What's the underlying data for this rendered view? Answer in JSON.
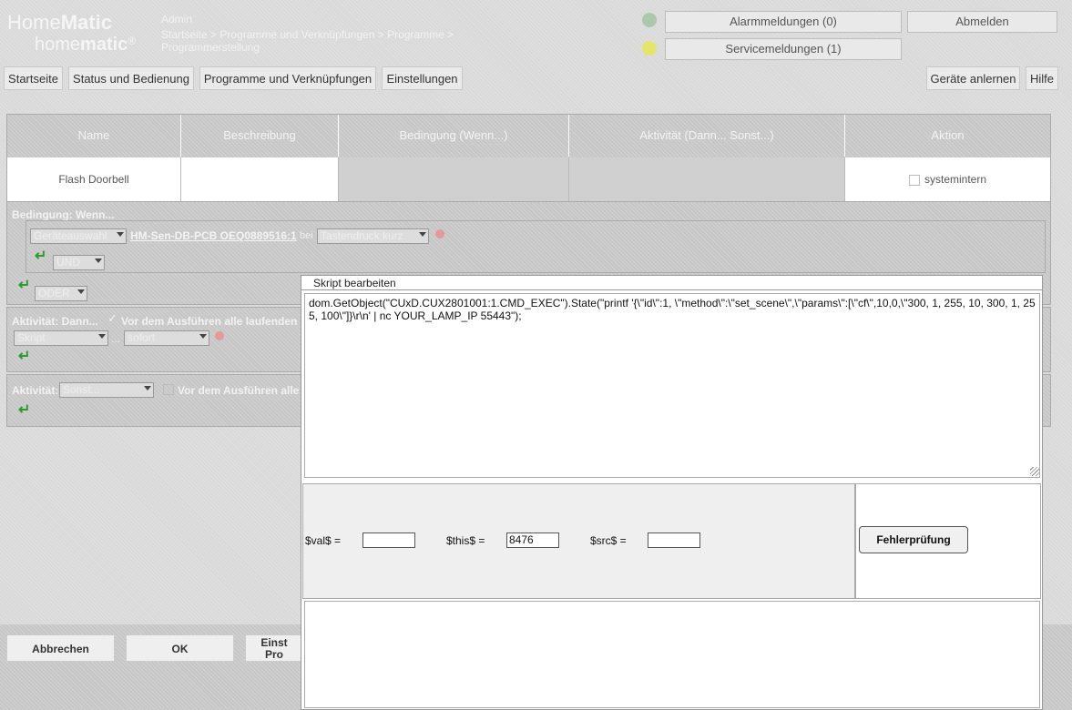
{
  "header": {
    "logo_home": "Home",
    "logo_matic": "Matic",
    "logo_sub_home": "home",
    "logo_sub_matic": "matic",
    "user": "Admin",
    "breadcrumb_line1": "Startseite > Programme und Verknüpfungen > Programme >",
    "breadcrumb_line2": "Programmerstellung",
    "alarm_label": "Alarmmeldungen (0)",
    "service_label": "Servicemeldungen (1)",
    "logout_label": "Abmelden",
    "alarm_led_color": "#a9c9a9",
    "service_led_color": "#e5e56a"
  },
  "nav": {
    "items": [
      "Startseite",
      "Status und Bedienung",
      "Programme und Verknüpfungen",
      "Einstellungen"
    ],
    "right_items": [
      "Geräte anlernen",
      "Hilfe"
    ]
  },
  "table": {
    "headers": [
      "Name",
      "Beschreibung",
      "Bedingung (Wenn...)",
      "Aktivität (Dann... Sonst...)",
      "Aktion"
    ],
    "row": {
      "name": "Flash Doorbell",
      "description": "",
      "action_label": "systemintern"
    }
  },
  "condition": {
    "title": "Bedingung: Wenn...",
    "device_select": "Geräteauswahl",
    "device_name": "HM-Sen-DB-PCB OEQ0889516:1",
    "bei_label": "bei",
    "trigger_select": "Tastendruck kurz",
    "und_select": "UND",
    "oder_select": "ODER"
  },
  "activity_then": {
    "title": "Aktivität: Dann...",
    "stop_label": "Vor dem Ausführen alle laufenden",
    "type_select": "Skript",
    "time_select": "sofort",
    "dots": "..."
  },
  "activity_else": {
    "title": "Aktivität:",
    "select": "Sonst...",
    "stop_label": "Vor dem Ausführen alle"
  },
  "dialog": {
    "title": "Skript bearbeiten",
    "script": "dom.GetObject(\"CUxD.CUX2801001:1.CMD_EXEC\").State(\"printf '{\\\"id\\\":1, \\\"method\\\":\\\"set_scene\\\",\\\"params\\\":[\\\"cf\\\",10,0,\\\"300, 1, 255, 10, 300, 1, 255, 100\\\"]}\\r\\n' | nc YOUR_LAMP_IP 55443\");",
    "val_label": "$val$ =",
    "val_value": "",
    "this_label": "$this$ =",
    "this_value": "8476",
    "src_label": "$src$ =",
    "src_value": "",
    "check_label": "Fehlerprüfung"
  },
  "footer": {
    "cancel": "Abbrechen",
    "ok": "OK",
    "settings_line1": "Einst",
    "settings_line2": "Pro"
  }
}
